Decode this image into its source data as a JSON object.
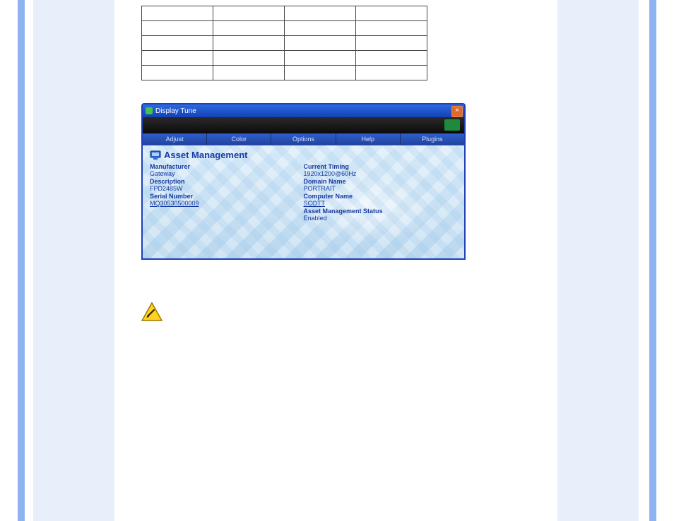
{
  "table": {
    "rows": 5,
    "cols": 4
  },
  "window": {
    "title": "Display Tune",
    "tabs": [
      "Adjust",
      "Color",
      "Options",
      "Help",
      "Plugins"
    ],
    "heading": "Asset Management",
    "left": [
      {
        "label": "Manufacturer",
        "value": "Gateway",
        "underline": false
      },
      {
        "label": "Description",
        "value": "FPD2485W",
        "underline": false
      },
      {
        "label": "Serial Number",
        "value": "MQ30530500009",
        "underline": true
      }
    ],
    "right": [
      {
        "label": "Current Timing",
        "value": "1920x1200@60Hz",
        "underline": false
      },
      {
        "label": "Domain Name",
        "value": "PORTRAIT",
        "underline": false
      },
      {
        "label": "Computer Name",
        "value": "SCOTT",
        "underline": true
      },
      {
        "label": "Asset Management Status",
        "value": "Enabled",
        "underline": false
      }
    ]
  },
  "warning_icon": "write-caution-icon"
}
